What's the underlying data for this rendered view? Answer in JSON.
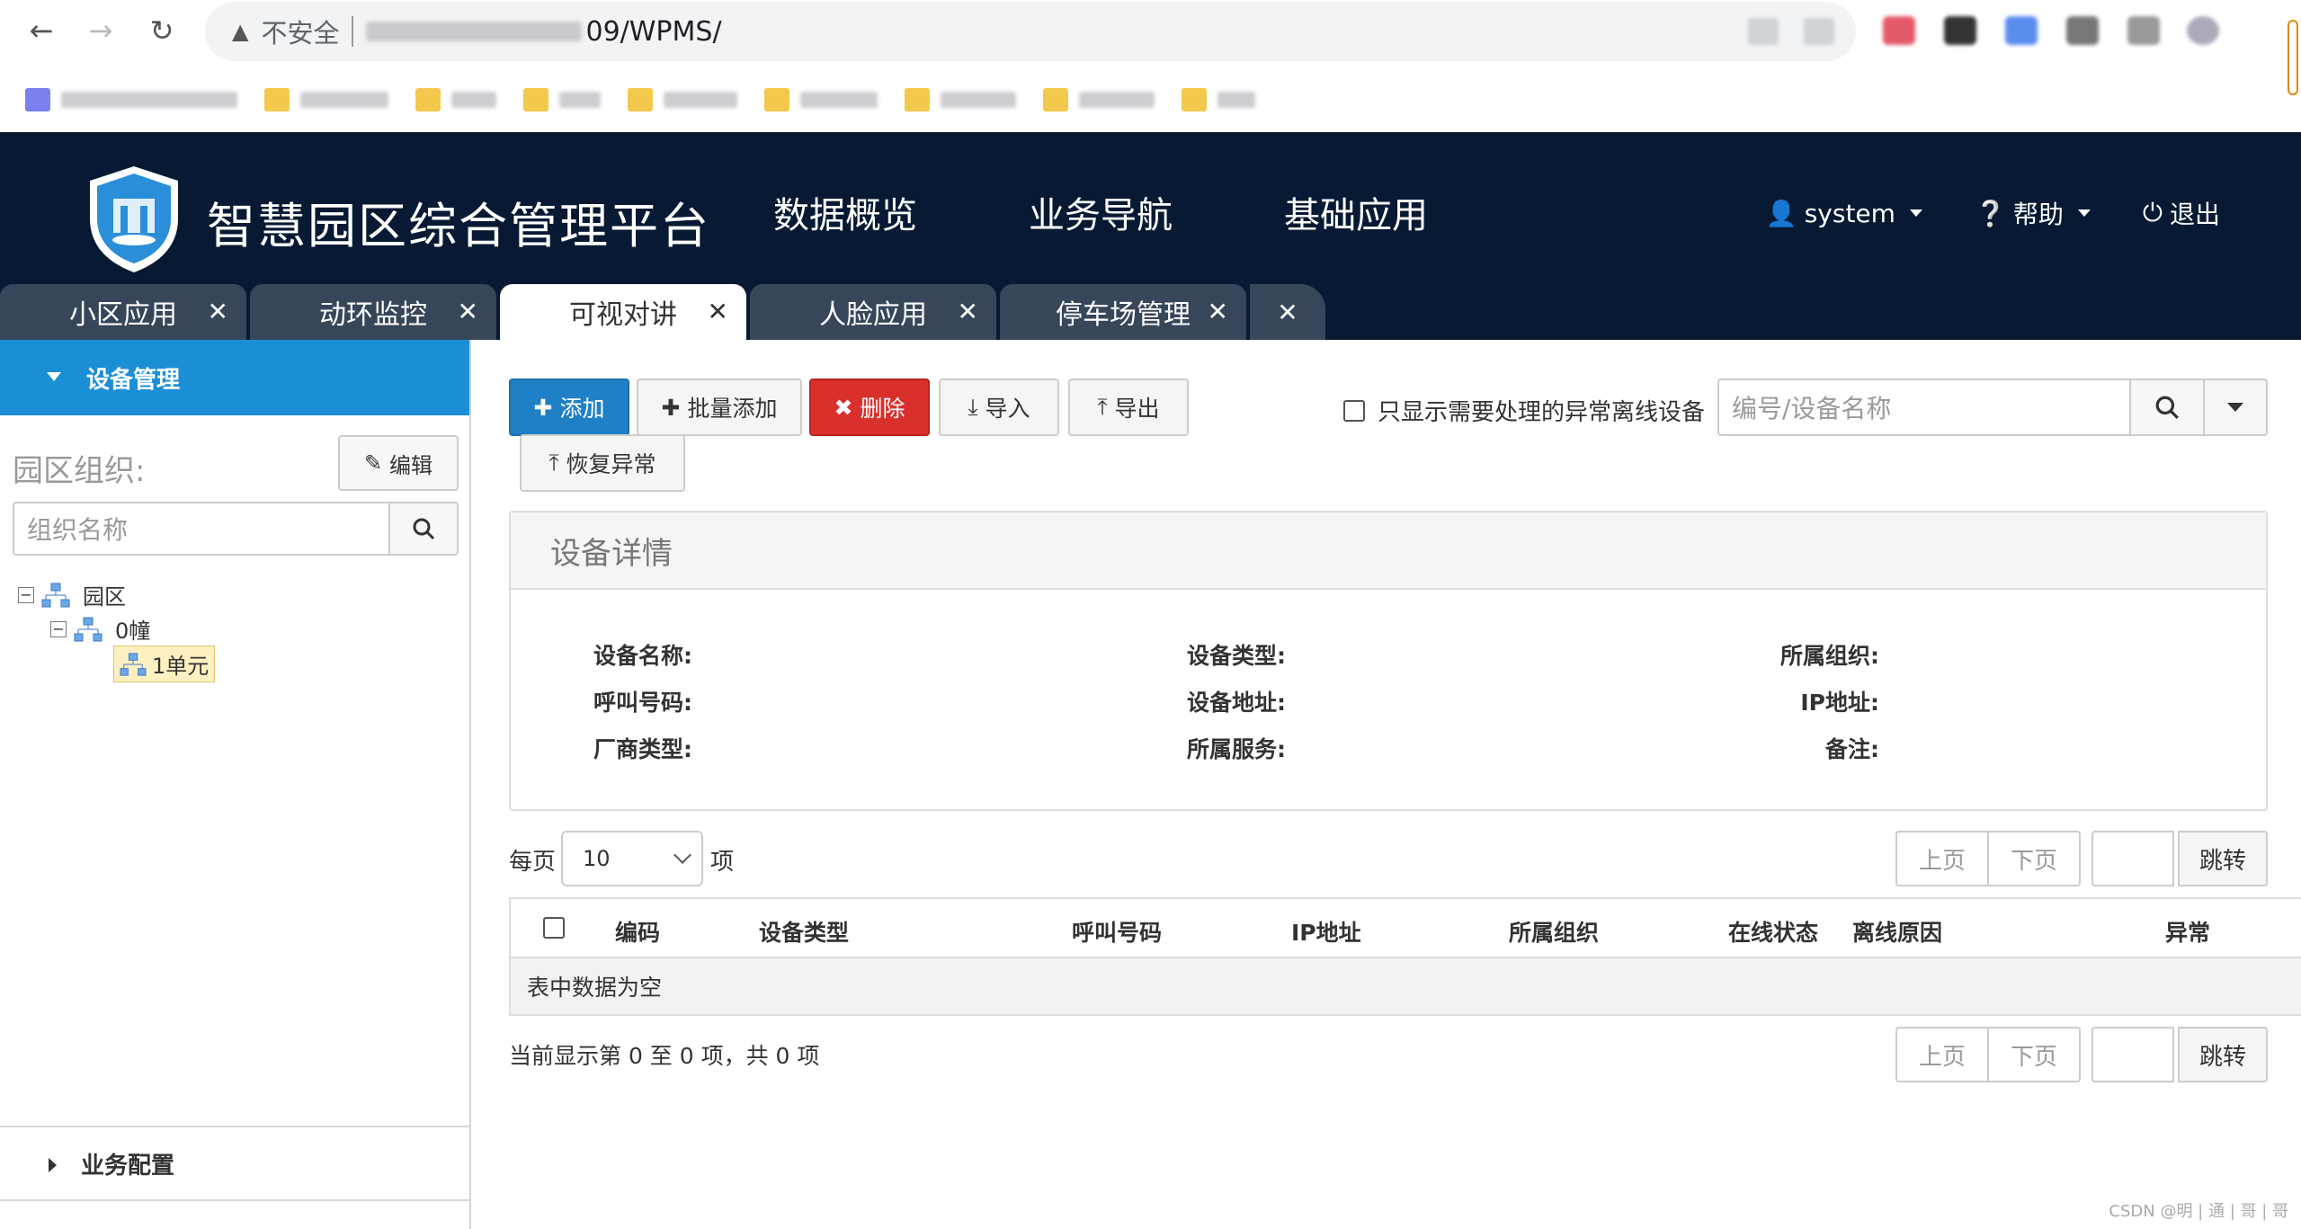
{
  "browser": {
    "insecure_label": "不安全",
    "url": "09/WPMS/"
  },
  "app": {
    "title": "智慧园区综合管理平台",
    "nav": [
      "数据概览",
      "业务导航",
      "基础应用"
    ],
    "user": "system",
    "help": "帮助",
    "logout": "退出"
  },
  "tabs": [
    {
      "label": "小区应用",
      "active": false
    },
    {
      "label": "动环监控",
      "active": false
    },
    {
      "label": "可视对讲",
      "active": true
    },
    {
      "label": "人脸应用",
      "active": false
    },
    {
      "label": "停车场管理",
      "active": false
    }
  ],
  "sidebar": {
    "section_title": "设备管理",
    "org_label": "园区组织:",
    "edit_label": "编辑",
    "org_placeholder": "组织名称",
    "tree": [
      {
        "label": "园区",
        "level": 0,
        "expanded": true
      },
      {
        "label": "0幢",
        "level": 1,
        "expanded": true
      },
      {
        "label": "1单元",
        "level": 2,
        "selected": true
      }
    ],
    "footer_section": "业务配置"
  },
  "toolbar": {
    "add": "添加",
    "batch_add": "批量添加",
    "delete": "删除",
    "import": "导入",
    "export": "导出",
    "restore": "恢复异常",
    "filter_label": "只显示需要处理的异常离线设备",
    "search_placeholder": "编号/设备名称"
  },
  "detail_panel": {
    "title": "设备详情",
    "fields": [
      "设备名称:",
      "设备类型:",
      "所属组织:",
      "呼叫号码:",
      "设备地址:",
      "IP地址:",
      "厂商类型:",
      "所属服务:",
      "备注:"
    ]
  },
  "pager": {
    "per_page_label": "每页",
    "per_page_value": "10",
    "per_page_unit": "项",
    "prev": "上页",
    "next": "下页",
    "go": "跳转"
  },
  "table": {
    "columns": [
      "编码",
      "设备类型",
      "呼叫号码",
      "IP地址",
      "所属组织",
      "在线状态",
      "离线原因",
      "异常"
    ],
    "empty_text": "表中数据为空",
    "summary": "当前显示第 0 至 0 项，共 0 项"
  },
  "watermark": "CSDN @明 | 通 | 哥 | 哥",
  "colors": {
    "header_bg": "#081a33",
    "tab_bg": "#38465a",
    "primary": "#1f7fc7",
    "danger": "#d9302c",
    "sidebar_active": "#1a8fd6"
  }
}
